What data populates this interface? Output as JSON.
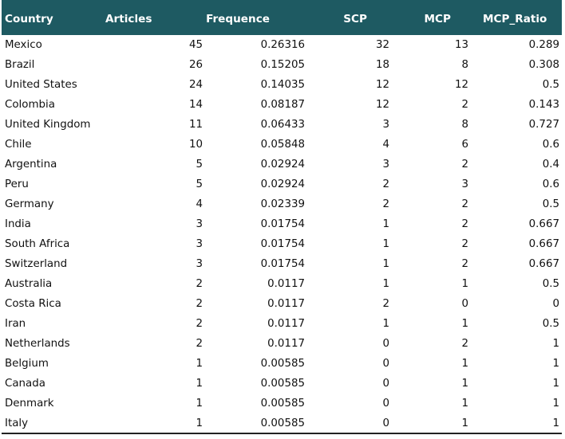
{
  "headers": {
    "country": "Country",
    "articles": "Articles",
    "frequence": "Frequence",
    "scp": "SCP",
    "mcp": "MCP",
    "mcp_ratio": "MCP_Ratio"
  },
  "rows": [
    {
      "country": "Mexico",
      "articles": "45",
      "frequence": "0.26316",
      "scp": "32",
      "mcp": "13",
      "mcp_ratio": "0.289"
    },
    {
      "country": "Brazil",
      "articles": "26",
      "frequence": "0.15205",
      "scp": "18",
      "mcp": "8",
      "mcp_ratio": "0.308"
    },
    {
      "country": "United States",
      "articles": "24",
      "frequence": "0.14035",
      "scp": "12",
      "mcp": "12",
      "mcp_ratio": "0.5"
    },
    {
      "country": "Colombia",
      "articles": "14",
      "frequence": "0.08187",
      "scp": "12",
      "mcp": "2",
      "mcp_ratio": "0.143"
    },
    {
      "country": "United Kingdom",
      "articles": "11",
      "frequence": "0.06433",
      "scp": "3",
      "mcp": "8",
      "mcp_ratio": "0.727"
    },
    {
      "country": "Chile",
      "articles": "10",
      "frequence": "0.05848",
      "scp": "4",
      "mcp": "6",
      "mcp_ratio": "0.6"
    },
    {
      "country": "Argentina",
      "articles": "5",
      "frequence": "0.02924",
      "scp": "3",
      "mcp": "2",
      "mcp_ratio": "0.4"
    },
    {
      "country": "Peru",
      "articles": "5",
      "frequence": "0.02924",
      "scp": "2",
      "mcp": "3",
      "mcp_ratio": "0.6"
    },
    {
      "country": "Germany",
      "articles": "4",
      "frequence": "0.02339",
      "scp": "2",
      "mcp": "2",
      "mcp_ratio": "0.5"
    },
    {
      "country": "India",
      "articles": "3",
      "frequence": "0.01754",
      "scp": "1",
      "mcp": "2",
      "mcp_ratio": "0.667"
    },
    {
      "country": "South Africa",
      "articles": "3",
      "frequence": "0.01754",
      "scp": "1",
      "mcp": "2",
      "mcp_ratio": "0.667"
    },
    {
      "country": "Switzerland",
      "articles": "3",
      "frequence": "0.01754",
      "scp": "1",
      "mcp": "2",
      "mcp_ratio": "0.667"
    },
    {
      "country": "Australia",
      "articles": "2",
      "frequence": "0.0117",
      "scp": "1",
      "mcp": "1",
      "mcp_ratio": "0.5"
    },
    {
      "country": "Costa Rica",
      "articles": "2",
      "frequence": "0.0117",
      "scp": "2",
      "mcp": "0",
      "mcp_ratio": "0"
    },
    {
      "country": "Iran",
      "articles": "2",
      "frequence": "0.0117",
      "scp": "1",
      "mcp": "1",
      "mcp_ratio": "0.5"
    },
    {
      "country": "Netherlands",
      "articles": "2",
      "frequence": "0.0117",
      "scp": "0",
      "mcp": "2",
      "mcp_ratio": "1"
    },
    {
      "country": "Belgium",
      "articles": "1",
      "frequence": "0.00585",
      "scp": "0",
      "mcp": "1",
      "mcp_ratio": "1"
    },
    {
      "country": "Canada",
      "articles": "1",
      "frequence": "0.00585",
      "scp": "0",
      "mcp": "1",
      "mcp_ratio": "1"
    },
    {
      "country": "Denmark",
      "articles": "1",
      "frequence": "0.00585",
      "scp": "0",
      "mcp": "1",
      "mcp_ratio": "1"
    },
    {
      "country": "Italy",
      "articles": "1",
      "frequence": "0.00585",
      "scp": "0",
      "mcp": "1",
      "mcp_ratio": "1"
    }
  ],
  "colors": {
    "header_bg": "#1e5a62",
    "header_text": "#ffffff",
    "body_text": "#111111"
  }
}
